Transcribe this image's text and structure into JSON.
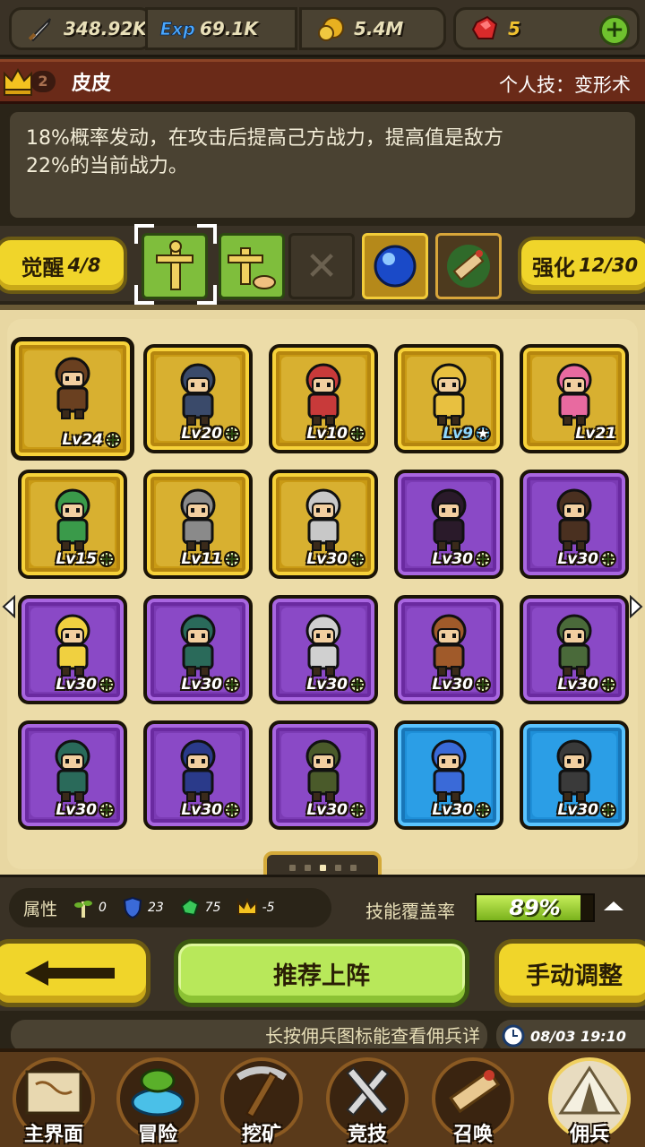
{
  "resources": {
    "attack": "348.92K",
    "exp_label": "Exp",
    "exp": "69.1K",
    "gold": "5.4M",
    "gems": "5"
  },
  "hero": {
    "rank": "2",
    "name": "皮皮",
    "skill_tag": "个人技：变形术",
    "description_line1": "18%概率发动，在攻击后提高己方战力，提高值是敌方",
    "description_line2": "22%的当前战力。"
  },
  "awaken": {
    "awaken_label": "觉醒",
    "awaken_count": "4/8",
    "enhance_label": "强化",
    "enhance_count": "12/30"
  },
  "cards": [
    {
      "level": "Lv24",
      "rarity": "gold",
      "badge": "plus"
    },
    {
      "level": "Lv20",
      "rarity": "gold",
      "badge": "plus"
    },
    {
      "level": "Lv10",
      "rarity": "gold",
      "badge": "plus"
    },
    {
      "level": "Lv9",
      "rarity": "gold",
      "badge": "star"
    },
    {
      "level": "Lv21",
      "rarity": "gold",
      "badge": "none"
    },
    {
      "level": "Lv15",
      "rarity": "gold",
      "badge": "plus"
    },
    {
      "level": "Lv11",
      "rarity": "gold",
      "badge": "plus"
    },
    {
      "level": "Lv30",
      "rarity": "gold",
      "badge": "plus"
    },
    {
      "level": "Lv30",
      "rarity": "purple",
      "badge": "plus"
    },
    {
      "level": "Lv30",
      "rarity": "purple",
      "badge": "plus"
    },
    {
      "level": "Lv30",
      "rarity": "purple",
      "badge": "plus"
    },
    {
      "level": "Lv30",
      "rarity": "purple",
      "badge": "plus"
    },
    {
      "level": "Lv30",
      "rarity": "purple",
      "badge": "plus"
    },
    {
      "level": "Lv30",
      "rarity": "purple",
      "badge": "plus"
    },
    {
      "level": "Lv30",
      "rarity": "purple",
      "badge": "plus"
    },
    {
      "level": "Lv30",
      "rarity": "purple",
      "badge": "plus"
    },
    {
      "level": "Lv30",
      "rarity": "purple",
      "badge": "plus"
    },
    {
      "level": "Lv30",
      "rarity": "purple",
      "badge": "plus"
    },
    {
      "level": "Lv30",
      "rarity": "blue",
      "badge": "plus"
    },
    {
      "level": "Lv30",
      "rarity": "blue",
      "badge": "plus"
    }
  ],
  "stats": {
    "label": "属性",
    "nature": "0",
    "defense": "23",
    "vitality": "75",
    "crown": "-5",
    "coverage_label": "技能覆盖率",
    "coverage": "89%",
    "coverage_fraction": 0.89
  },
  "actions": {
    "recommend": "推荐上阵",
    "manual": "手动调整"
  },
  "hint": "长按佣兵图标能查看佣兵详",
  "datetime": "08/03 19:10",
  "nav": {
    "home": "主界面",
    "adventure": "冒险",
    "mine": "挖矿",
    "arena": "竞技",
    "summon": "召唤",
    "mercenary": "佣兵"
  },
  "colors": {
    "accent_yellow": "#f0d52a",
    "accent_green": "#b8e85a",
    "rarity_gold": "#c99a14",
    "rarity_purple": "#7b3bb4",
    "rarity_blue": "#1e8fd8"
  }
}
